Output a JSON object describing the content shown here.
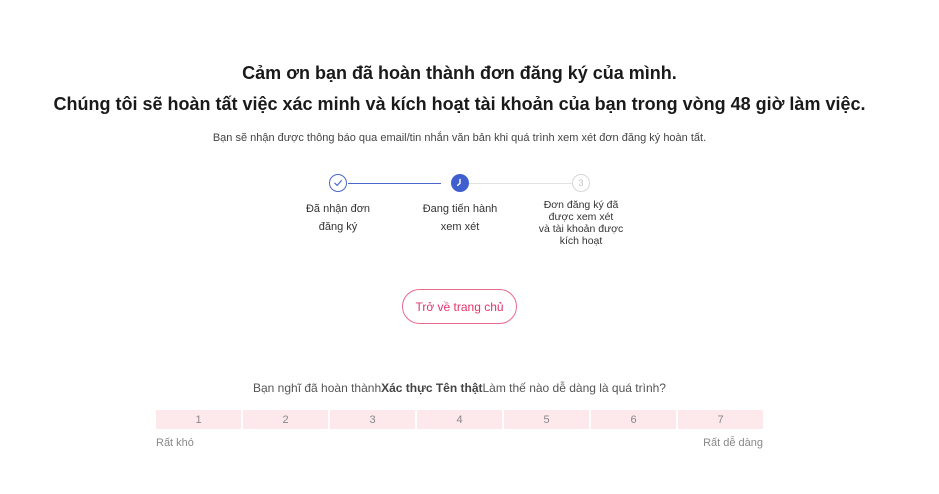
{
  "header": {
    "thanks": "Cảm ơn bạn đã hoàn thành đơn đăng ký của mình.",
    "verification": "Chúng tôi sẽ hoàn tất việc xác minh và kích hoạt tài khoản của bạn trong vòng 48 giờ làm việc.",
    "notice": "Bạn sẽ nhận được thông báo qua email/tin nhắn văn bản khi quá trình xem xét đơn đăng ký hoàn tất."
  },
  "stepper": {
    "current_step": 2,
    "steps": [
      {
        "number": "1",
        "status": "completed",
        "icon": "check-icon",
        "label_lines": [
          "Đã nhận đơn",
          "đăng ký"
        ]
      },
      {
        "number": "2",
        "status": "in-progress",
        "icon": "clock-icon",
        "label_lines": [
          "Đang tiến hành",
          "xem xét"
        ]
      },
      {
        "number": "3",
        "status": "pending",
        "icon": "",
        "label_lines": [
          "Đơn đăng ký đã",
          "được xem xét",
          "và tài khoản được",
          "kích hoạt"
        ]
      }
    ]
  },
  "actions": {
    "home_label": "Trở về trang chủ"
  },
  "survey": {
    "question_prefix": "Bạn nghĩ đã hoàn thành",
    "question_bold": "Xác thực Tên thật",
    "question_suffix": "Làm thế nào dễ dàng là quá trình?",
    "scale": [
      "1",
      "2",
      "3",
      "4",
      "5",
      "6",
      "7"
    ],
    "low_label": "Rất khó",
    "high_label": "Rất dễ dàng"
  },
  "colors": {
    "accent": "#3f5fcf",
    "button_text": "#e2336b",
    "button_border": "#e86a8e",
    "rating_bg": "#fde8ec"
  }
}
